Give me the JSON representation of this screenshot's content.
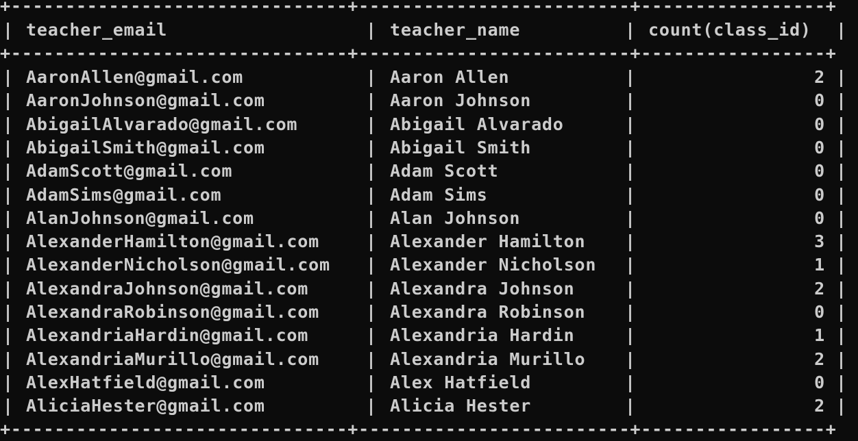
{
  "columns": {
    "email": "teacher_email",
    "name": "teacher_name",
    "count": "count(class_id)"
  },
  "separator": "+-------------------------------+-------------------------+-----------------+",
  "pipe": "|",
  "rows": [
    {
      "email": "AaronAllen@gmail.com",
      "name": "Aaron Allen",
      "count": "2"
    },
    {
      "email": "AaronJohnson@gmail.com",
      "name": "Aaron Johnson",
      "count": "0"
    },
    {
      "email": "AbigailAlvarado@gmail.com",
      "name": "Abigail Alvarado",
      "count": "0"
    },
    {
      "email": "AbigailSmith@gmail.com",
      "name": "Abigail Smith",
      "count": "0"
    },
    {
      "email": "AdamScott@gmail.com",
      "name": "Adam Scott",
      "count": "0"
    },
    {
      "email": "AdamSims@gmail.com",
      "name": "Adam Sims",
      "count": "0"
    },
    {
      "email": "AlanJohnson@gmail.com",
      "name": "Alan Johnson",
      "count": "0"
    },
    {
      "email": "AlexanderHamilton@gmail.com",
      "name": "Alexander Hamilton",
      "count": "3"
    },
    {
      "email": "AlexanderNicholson@gmail.com",
      "name": "Alexander Nicholson",
      "count": "1"
    },
    {
      "email": "AlexandraJohnson@gmail.com",
      "name": "Alexandra Johnson",
      "count": "2"
    },
    {
      "email": "AlexandraRobinson@gmail.com",
      "name": "Alexandra Robinson",
      "count": "0"
    },
    {
      "email": "AlexandriaHardin@gmail.com",
      "name": "Alexandria Hardin",
      "count": "1"
    },
    {
      "email": "AlexandriaMurillo@gmail.com",
      "name": "Alexandria Murillo",
      "count": "2"
    },
    {
      "email": "AlexHatfield@gmail.com",
      "name": "Alex Hatfield",
      "count": "0"
    },
    {
      "email": "AliciaHester@gmail.com",
      "name": "Alicia Hester",
      "count": "2"
    }
  ]
}
